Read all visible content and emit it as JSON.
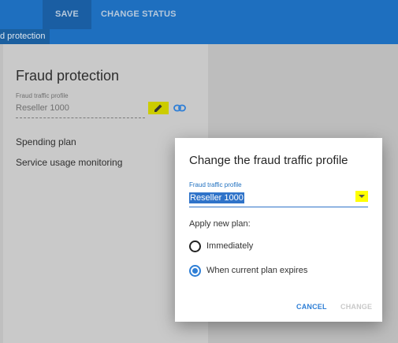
{
  "toolbar": {
    "save_label": "SAVE",
    "change_status_label": "CHANGE STATUS"
  },
  "tabs": {
    "active_label": "d protection"
  },
  "left_panel": {
    "title": "Fraud protection",
    "profile_field": {
      "label": "Fraud traffic profile",
      "value": "Reseller 1000"
    },
    "items": [
      {
        "label": "Spending plan"
      },
      {
        "label": "Service usage monitoring"
      }
    ]
  },
  "dialog": {
    "title": "Change the fraud traffic profile",
    "field": {
      "label": "Fraud traffic profile",
      "value": "Reseller 1000"
    },
    "apply_label": "Apply new plan:",
    "options": [
      {
        "label": "Immediately",
        "selected": false
      },
      {
        "label": "When current plan expires",
        "selected": true
      }
    ],
    "cancel_label": "CANCEL",
    "change_label": "CHANGE"
  },
  "colors": {
    "header_blue": "#1e6fbf",
    "accent_blue": "#2f7fd6",
    "highlight_yellow": "#ffff00"
  },
  "icons": {
    "edit": "pencil-icon",
    "link": "link-icon",
    "dropdown": "chevron-down-icon"
  }
}
